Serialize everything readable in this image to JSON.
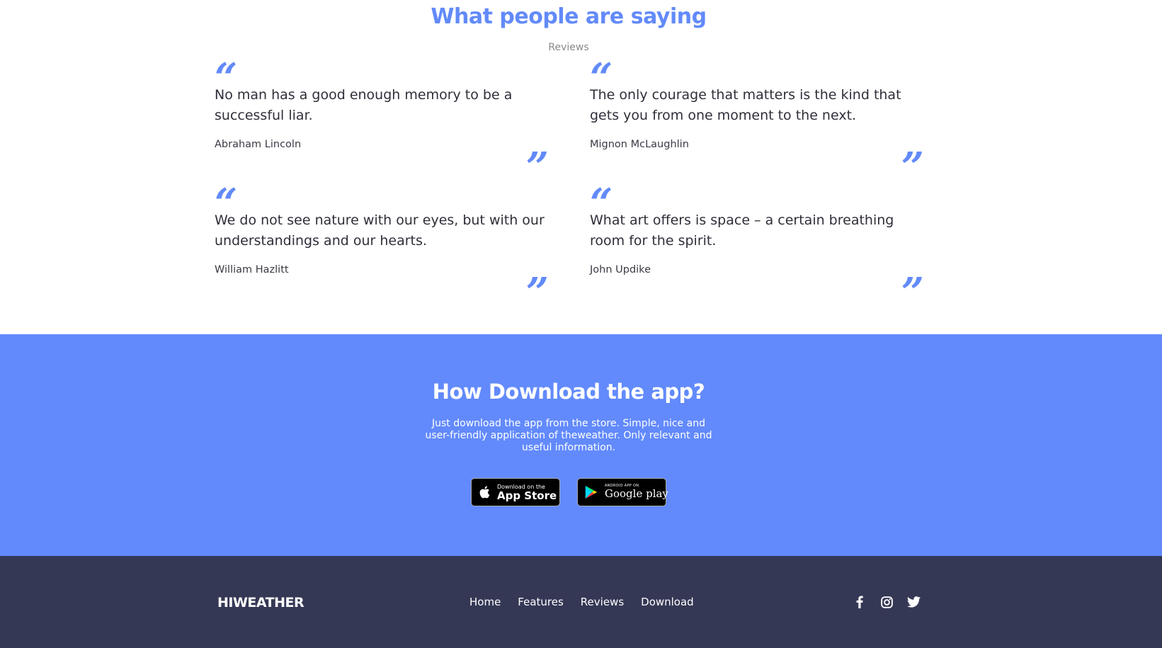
{
  "reviews": {
    "title": "What people are saying",
    "subtitle": "Reviews",
    "open_quote": "“",
    "close_quote": "”",
    "items": [
      {
        "text": "No man has a good enough memory to be a successful liar.",
        "author": "Abraham Lincoln"
      },
      {
        "text": "The only courage that matters is the kind that gets you from one moment to the next.",
        "author": "Mignon McLaughlin"
      },
      {
        "text": "We do not see nature with our eyes, but with our understandings and our hearts.",
        "author": "William Hazlitt"
      },
      {
        "text": "What art offers is space – a certain breathing room for the spirit.",
        "author": "John Updike"
      }
    ]
  },
  "download": {
    "title": "How Download the app?",
    "description": "Just download the app from the store. Simple, nice and user-friendly application of theweather. Only relevant and useful information.",
    "app_store": {
      "small_text": "Download on the",
      "big_text": "App Store",
      "icon": "apple-icon"
    },
    "google_play": {
      "small_text": "ANDROID APP ON",
      "big_text": "Google play",
      "icon": "google-play-icon"
    }
  },
  "footer": {
    "brand": "HIWEATHER",
    "nav": [
      "Home",
      "Features",
      "Reviews",
      "Download"
    ],
    "socials": [
      "facebook-icon",
      "instagram-icon",
      "twitter-icon"
    ]
  },
  "colors": {
    "accent": "#628af9",
    "download_bg": "#628afc",
    "footer_bg": "#353855",
    "text_dark": "#2f2f3a"
  }
}
